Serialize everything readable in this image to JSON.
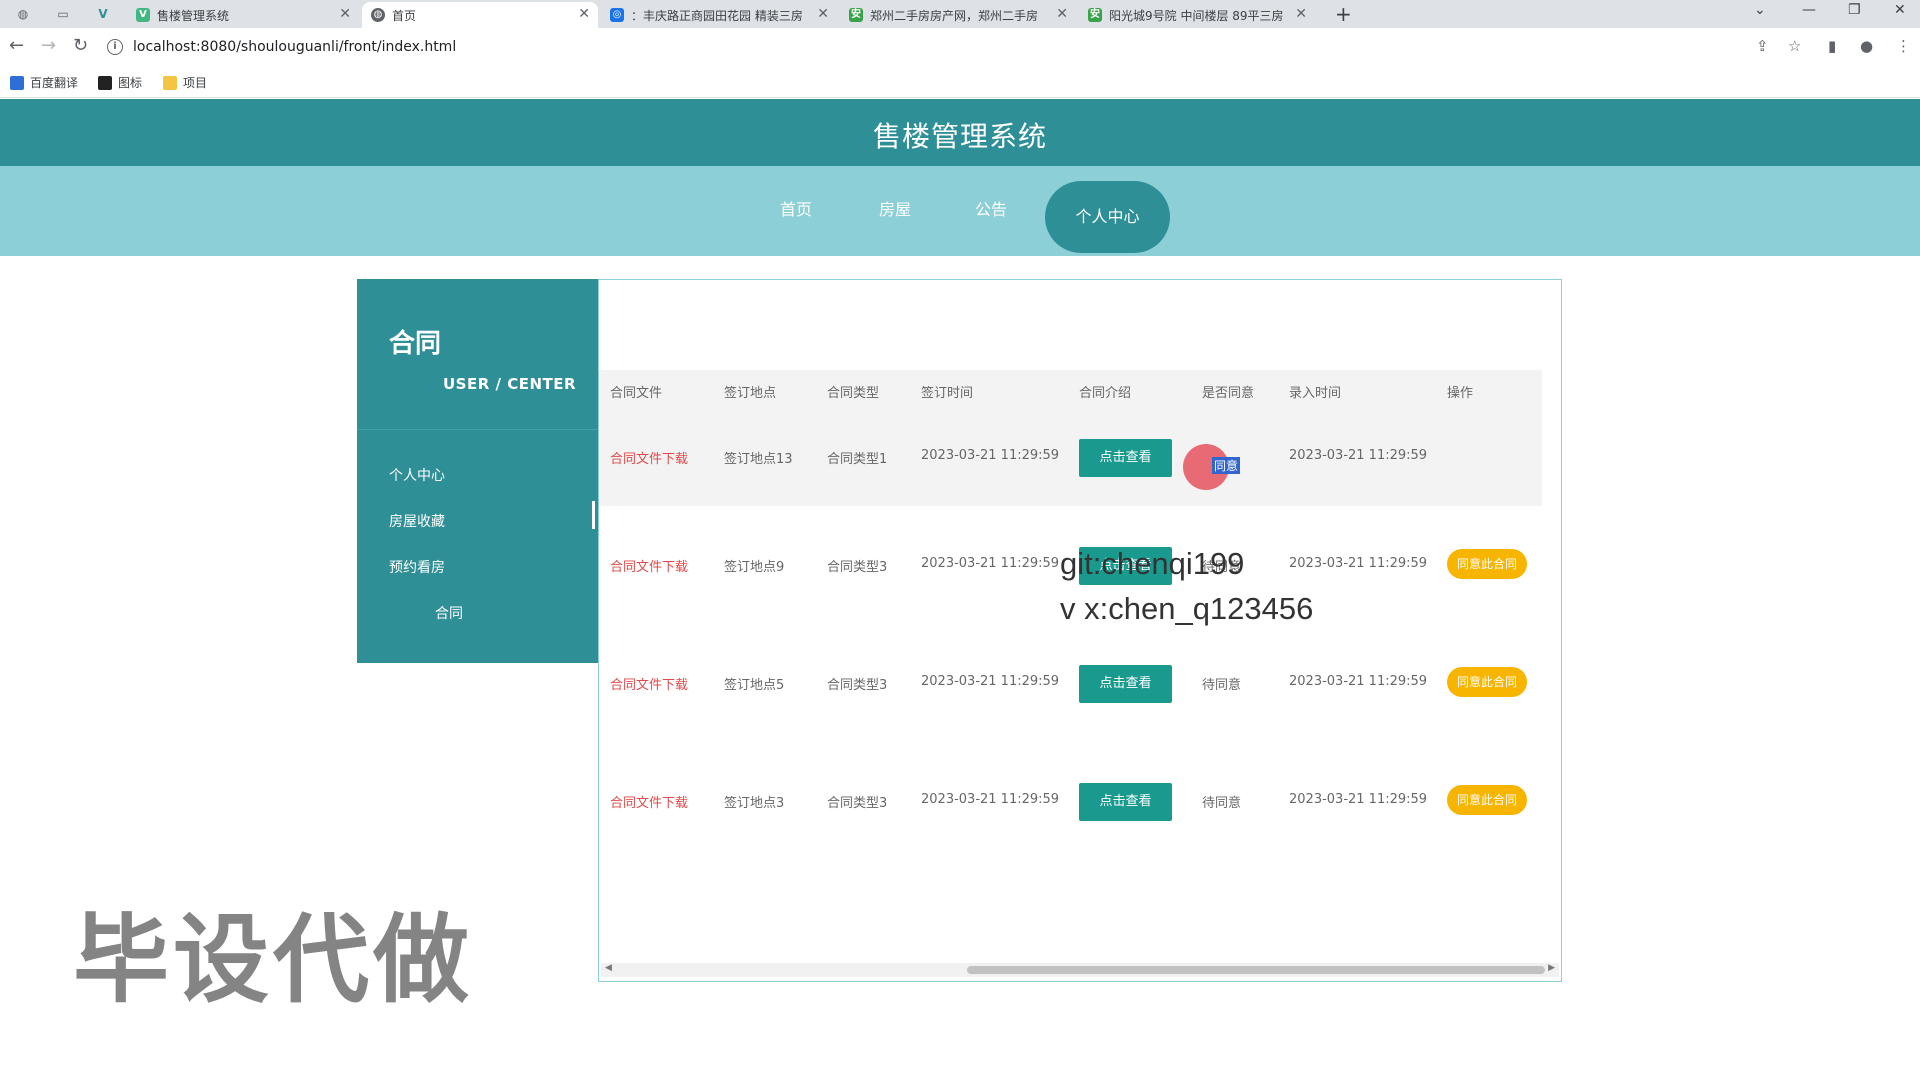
{
  "browser": {
    "tabs": [
      {
        "title": "售楼管理系统",
        "active": false,
        "favicon": "vue-icon"
      },
      {
        "title": "首页",
        "active": true,
        "favicon": "globe-icon"
      },
      {
        "title": "：丰庆路正商园田花园 精装三房",
        "active": false,
        "favicon": "site-icon"
      },
      {
        "title": "郑州二手房房产网，郑州二手房",
        "active": false,
        "favicon": "anjuke-icon"
      },
      {
        "title": "阳光城9号院 中间楼层 89平三房",
        "active": false,
        "favicon": "anjuke-icon"
      }
    ],
    "url": "localhost:8080/shoulouguanli/front/index.html",
    "bookmarks": [
      "百度翻译",
      "图标",
      "项目"
    ]
  },
  "site": {
    "title": "售楼管理系统",
    "nav": [
      "首页",
      "房屋",
      "公告",
      "个人中心"
    ],
    "active_nav": "个人中心"
  },
  "sidebar": {
    "title": "合同",
    "subtitle": "USER / CENTER",
    "items": [
      "个人中心",
      "房屋收藏",
      "预约看房",
      "合同"
    ]
  },
  "table": {
    "headers": [
      "合同文件",
      "签订地点",
      "合同类型",
      "签订时间",
      "合同介绍",
      "是否同意",
      "录入时间",
      "操作"
    ],
    "rows": [
      {
        "file": "合同文件下载",
        "place": "签订地点13",
        "type": "合同类型1",
        "signed": "2023-03-21 11:29:59",
        "intro": "点击查看",
        "agree": "同意",
        "created": "2023-03-21 11:29:59",
        "action": ""
      },
      {
        "file": "合同文件下载",
        "place": "签订地点9",
        "type": "合同类型3",
        "signed": "2023-03-21 11:29:59",
        "intro": "点击查看",
        "agree": "待同意",
        "created": "2023-03-21 11:29:59",
        "action": "同意此合同"
      },
      {
        "file": "合同文件下载",
        "place": "签订地点5",
        "type": "合同类型3",
        "signed": "2023-03-21 11:29:59",
        "intro": "点击查看",
        "agree": "待同意",
        "created": "2023-03-21 11:29:59",
        "action": "同意此合同"
      },
      {
        "file": "合同文件下载",
        "place": "签订地点3",
        "type": "合同类型3",
        "signed": "2023-03-21 11:29:59",
        "intro": "点击查看",
        "agree": "待同意",
        "created": "2023-03-21 11:29:59",
        "action": "同意此合同"
      }
    ]
  },
  "overlays": {
    "git": "git:chenqi199",
    "vx": "v x:chen_q123456",
    "watermark": "毕设代做"
  },
  "colors": {
    "header": "#2f8f96",
    "nav": "#8ccfd6",
    "view_button": "#1a9a8e",
    "agree_button": "#f7b500",
    "link_red": "#e04a4a"
  }
}
